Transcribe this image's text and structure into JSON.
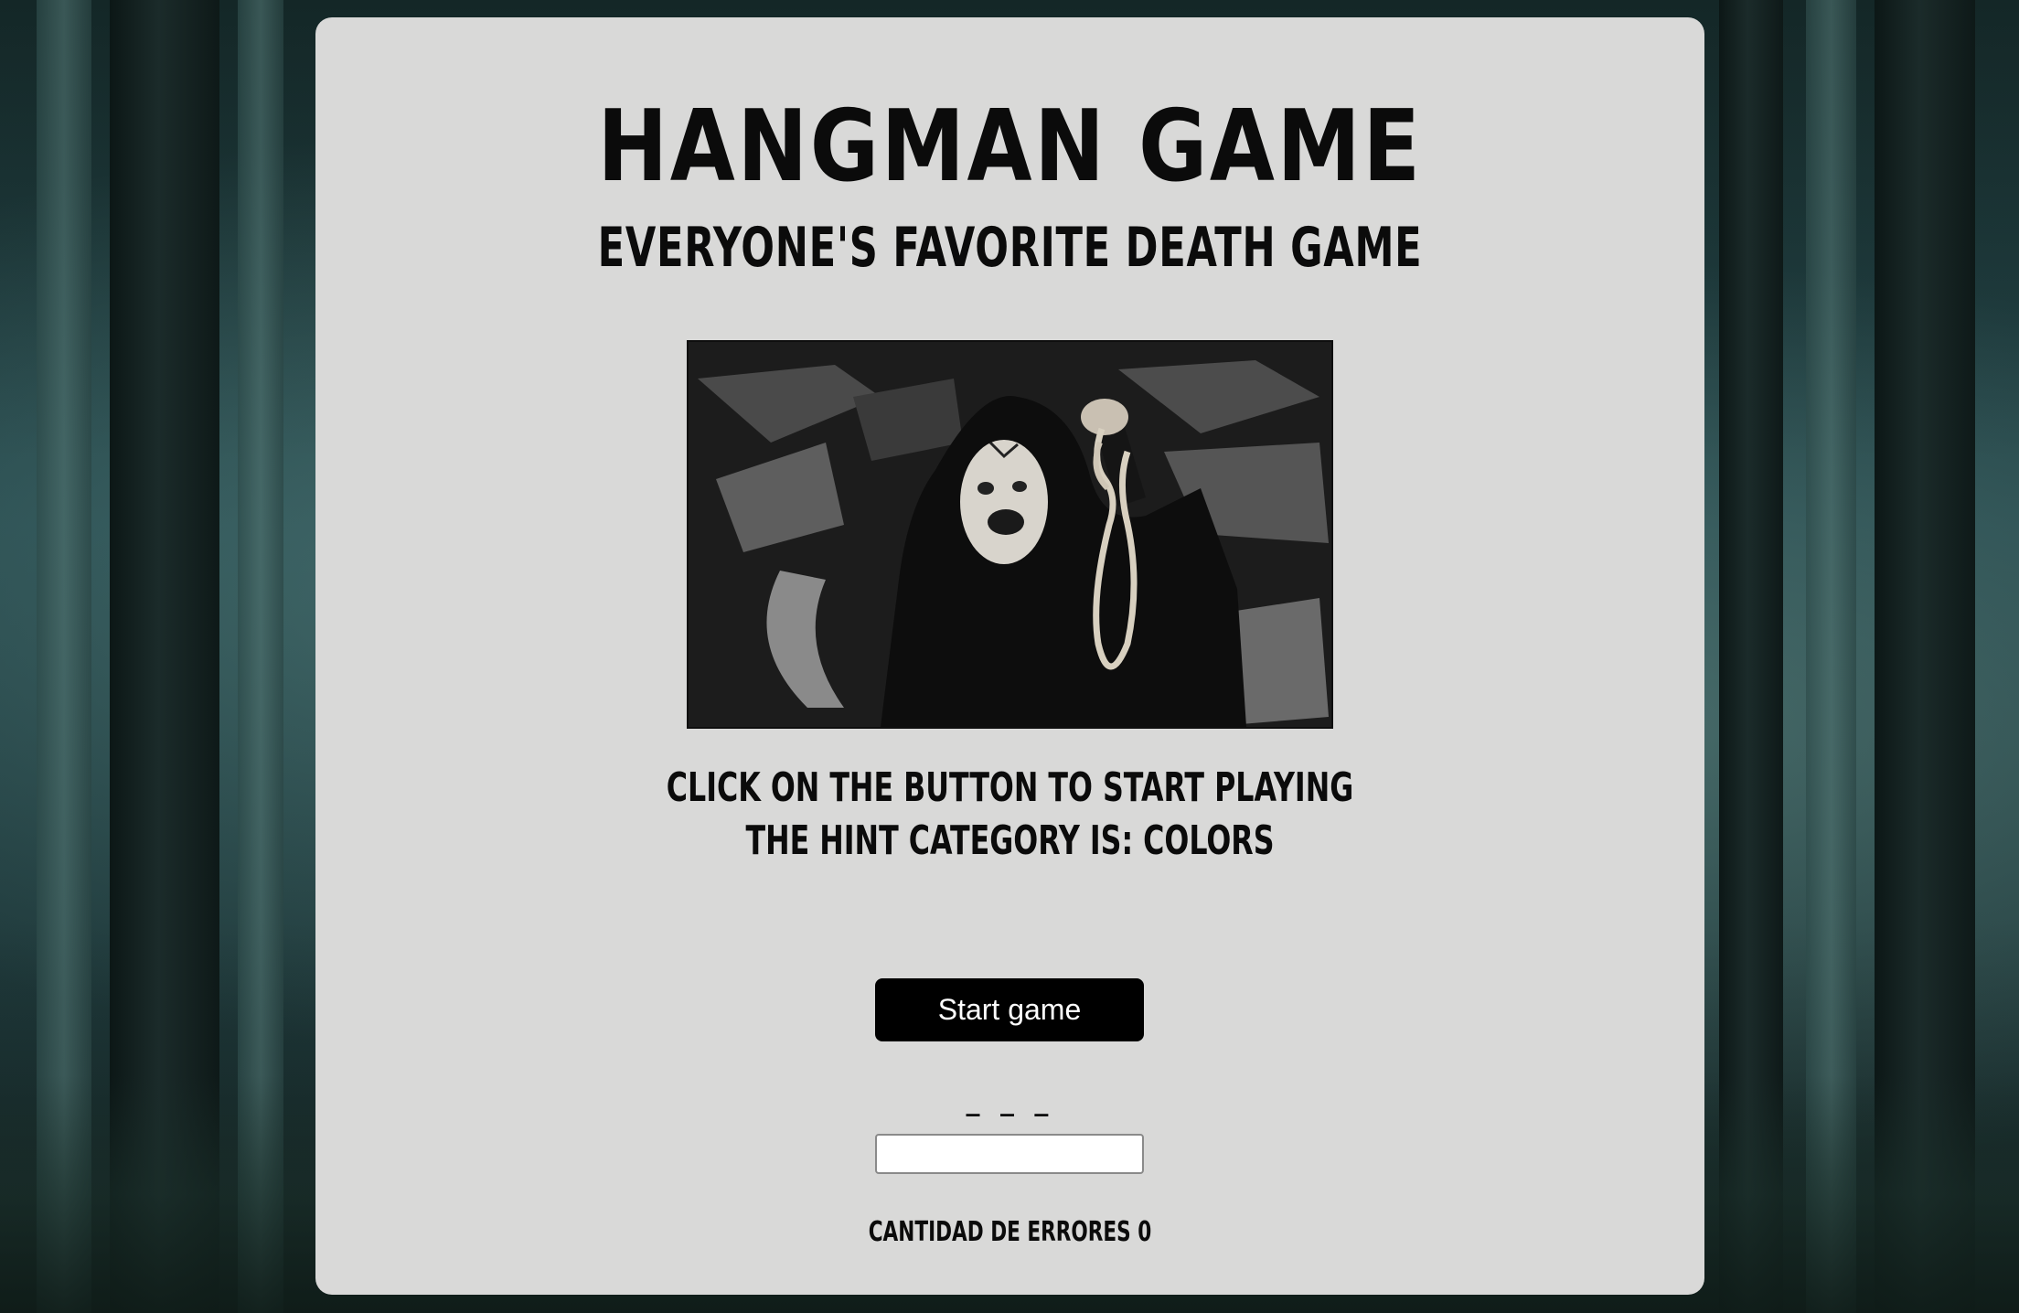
{
  "header": {
    "title": "HANGMAN GAME",
    "subtitle": "EVERYONE'S FAVORITE DEATH GAME"
  },
  "image": {
    "icon": "masked-figure-holding-noose-photo"
  },
  "instructions": {
    "line1": "CLICK ON THE BUTTON TO START PLAYING",
    "line2": "THE HINT CATEGORY IS: COLORS"
  },
  "controls": {
    "start_label": "Start game",
    "word_display": "_ _ _",
    "guess_value": ""
  },
  "status": {
    "errors_text": "CANTIDAD DE ERRORES 0"
  },
  "colors": {
    "card_bg": "#d9d9d8",
    "text": "#0b0b0b",
    "button_bg": "#000000",
    "button_text": "#ffffff",
    "forest_tone": "#24464a"
  }
}
